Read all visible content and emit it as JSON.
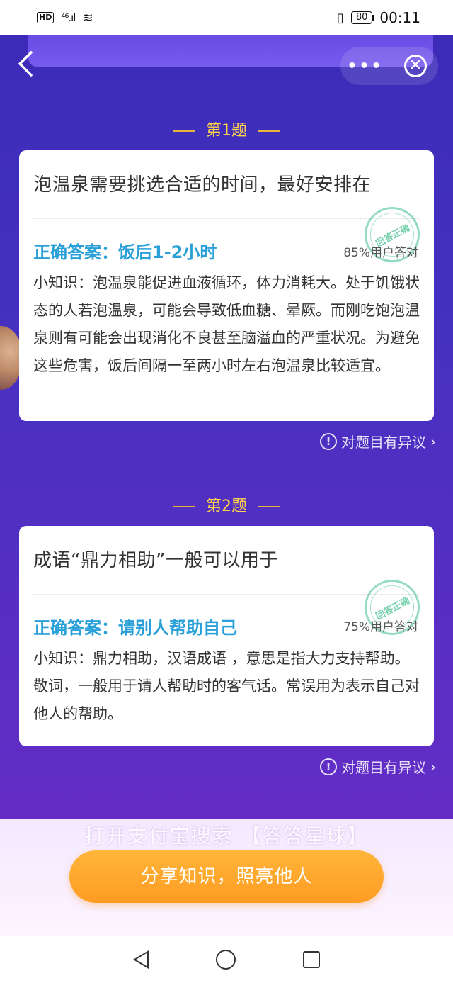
{
  "status_bar": {
    "hd": "HD",
    "signal": "⁴⁶.ıl",
    "wifi": "≋",
    "battery": "80",
    "time": "00:11"
  },
  "nav": {
    "back_icon": "chevron-left-icon",
    "more": "•••",
    "close": "✕"
  },
  "questions": [
    {
      "label": "第1题",
      "question": "泡温泉需要挑选合适的时间，最好安排在",
      "answer": "正确答案：饭后1-2小时",
      "percent": "85%用户答对",
      "stamp": "回答正确",
      "tip": "小知识：泡温泉能促进血液循环，体力消耗大。处于饥饿状态的人若泡温泉，可能会导致低血糖、晕厥。而刚吃饱泡温泉则有可能会出现消化不良甚至脑溢血的严重状况。为避免这些危害，饭后间隔一至两小时左右泡温泉比较适宜。",
      "objection": "对题目有异议"
    },
    {
      "label": "第2题",
      "question": "成语“鼎力相助”一般可以用于",
      "answer": "正确答案：请别人帮助自己",
      "percent": "75%用户答对",
      "stamp": "回答正确",
      "tip": "小知识：鼎力相助，汉语成语 ，意思是指大力支持帮助。敬词，一般用于请人帮助时的客气话。常误用为表示自己对他人的帮助。",
      "objection": "对题目有异议"
    }
  ],
  "promo": "打开支付宝搜索 【答答星球】",
  "share_button": "分享知识，照亮他人",
  "colors": {
    "background": "#4430c0",
    "answer": "#2aa0d8",
    "title_gold": "#ffd24c",
    "share_button": "#ffa52c"
  }
}
